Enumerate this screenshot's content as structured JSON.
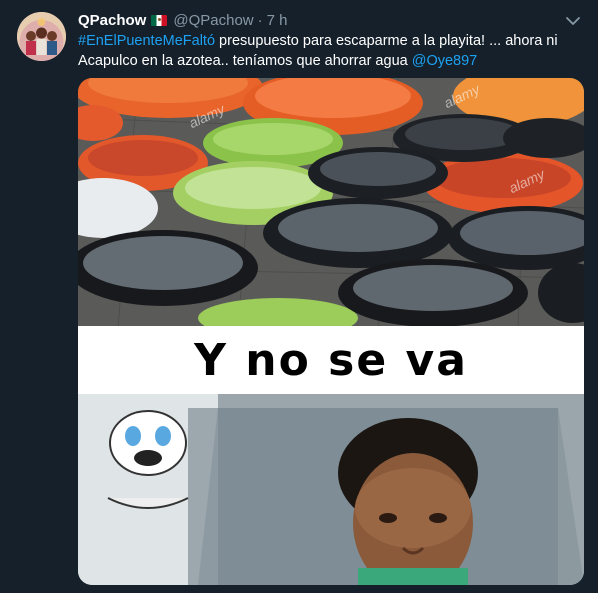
{
  "tweet": {
    "display_name": "QPachow",
    "flag_icon": "mexico-flag-icon",
    "handle": "@QPachow",
    "separator": "·",
    "time": "7 h",
    "hashtag": "#EnElPuenteMeFaltó",
    "text_1": " presupuesto para escaparme a la playita! ... ahora ni Acapulco en la azotea.. teníamos que ahorrar agua ",
    "mention": "@Oye897",
    "link_color": "#1da1f2",
    "background_color": "#15202b"
  },
  "media": {
    "caption": "Y no se va",
    "watermark": "alamy"
  }
}
